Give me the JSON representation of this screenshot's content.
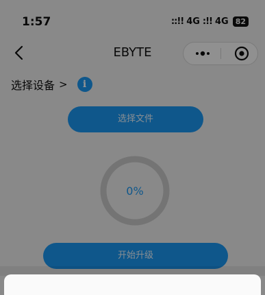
{
  "status": {
    "time": "1:57",
    "signal1": "::!!",
    "net1": "4G",
    "signal2": ":!!",
    "net2": "4G",
    "battery": "82"
  },
  "nav": {
    "title": "EBYTE"
  },
  "device": {
    "label": "选择设备",
    "chevron": ">",
    "info": "i"
  },
  "actions": {
    "select_file": "选择文件",
    "start_upgrade": "开始升级"
  },
  "progress": {
    "text": "0%",
    "value": 0
  },
  "colors": {
    "accent": "#1a96f0",
    "background": "#ededed"
  }
}
